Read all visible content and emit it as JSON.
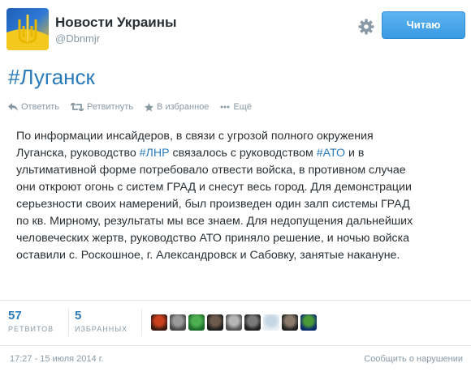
{
  "header": {
    "display_name": "Новости Украины",
    "handle": "@Dbnmjr",
    "follow_label": "Читаю",
    "avatar_icon": "ukraine-trident-flag-icon",
    "settings_icon": "gear-icon"
  },
  "hashtag_title": "#Луганск",
  "actions": {
    "reply": "Ответить",
    "retweet": "Ретвитнуть",
    "favorite": "В избранное",
    "more": "Ещё"
  },
  "tweet": {
    "lines": [
      [
        {
          "t": "По информации инсайдеров, в связи с угрозой полного окружения"
        }
      ],
      [
        {
          "t": "Луганска, руководство "
        },
        {
          "t": "#ЛНР",
          "hash": true
        },
        {
          "t": " связалось с руководством "
        },
        {
          "t": "#АТО",
          "hash": true
        },
        {
          "t": " и в"
        }
      ],
      [
        {
          "t": "ультимативной форме потребовало отвести войска, в противном случае"
        }
      ],
      [
        {
          "t": "они откроют огонь с систем ГРАД и снесут весь город. Для демонстрации"
        }
      ],
      [
        {
          "t": "серьезности своих намерений, был произведен один залп системы ГРАД"
        }
      ],
      [
        {
          "t": "по кв. Мирному, результаты мы все знаем. Для недопущения дальнейших"
        }
      ],
      [
        {
          "t": "человеческих жертв, руководство АТО приняло решение, и ночью войска"
        }
      ],
      [
        {
          "t": "оставили с. Роскошное, г. Александровск и Сабовку, занятые накануне."
        }
      ]
    ]
  },
  "stats": {
    "retweets_count": "57",
    "retweets_label": "РЕТВИТОВ",
    "favorites_count": "5",
    "favorites_label": "ИЗБРАННЫХ"
  },
  "faces": [
    {
      "name": "retweeter-avatar-1",
      "colors": [
        "#3a1a10",
        "#c8401e"
      ]
    },
    {
      "name": "retweeter-avatar-2",
      "colors": [
        "#4a4a4a",
        "#9a9a9a"
      ]
    },
    {
      "name": "retweeter-avatar-3",
      "colors": [
        "#1d6b2a",
        "#4caf50"
      ]
    },
    {
      "name": "retweeter-avatar-4",
      "colors": [
        "#1e1e1e",
        "#6d5a4c"
      ]
    },
    {
      "name": "retweeter-avatar-5",
      "colors": [
        "#555555",
        "#b5b5b5"
      ]
    },
    {
      "name": "retweeter-avatar-6",
      "colors": [
        "#222222",
        "#7a7a7a"
      ]
    },
    {
      "name": "retweeter-avatar-7",
      "colors": [
        "#e8eef3",
        "#c6d6e3"
      ]
    },
    {
      "name": "retweeter-avatar-8",
      "colors": [
        "#222222",
        "#8a7a6a"
      ]
    },
    {
      "name": "retweeter-avatar-9",
      "colors": [
        "#0d2a6b",
        "#4a9a3a"
      ]
    }
  ],
  "footer": {
    "timestamp": "17:27 - 15 июля 2014 г.",
    "report_label": "Сообщить о нарушении"
  },
  "colors": {
    "link": "#2b7bb9",
    "muted": "#8899a6",
    "button": "#3a9ae3"
  }
}
